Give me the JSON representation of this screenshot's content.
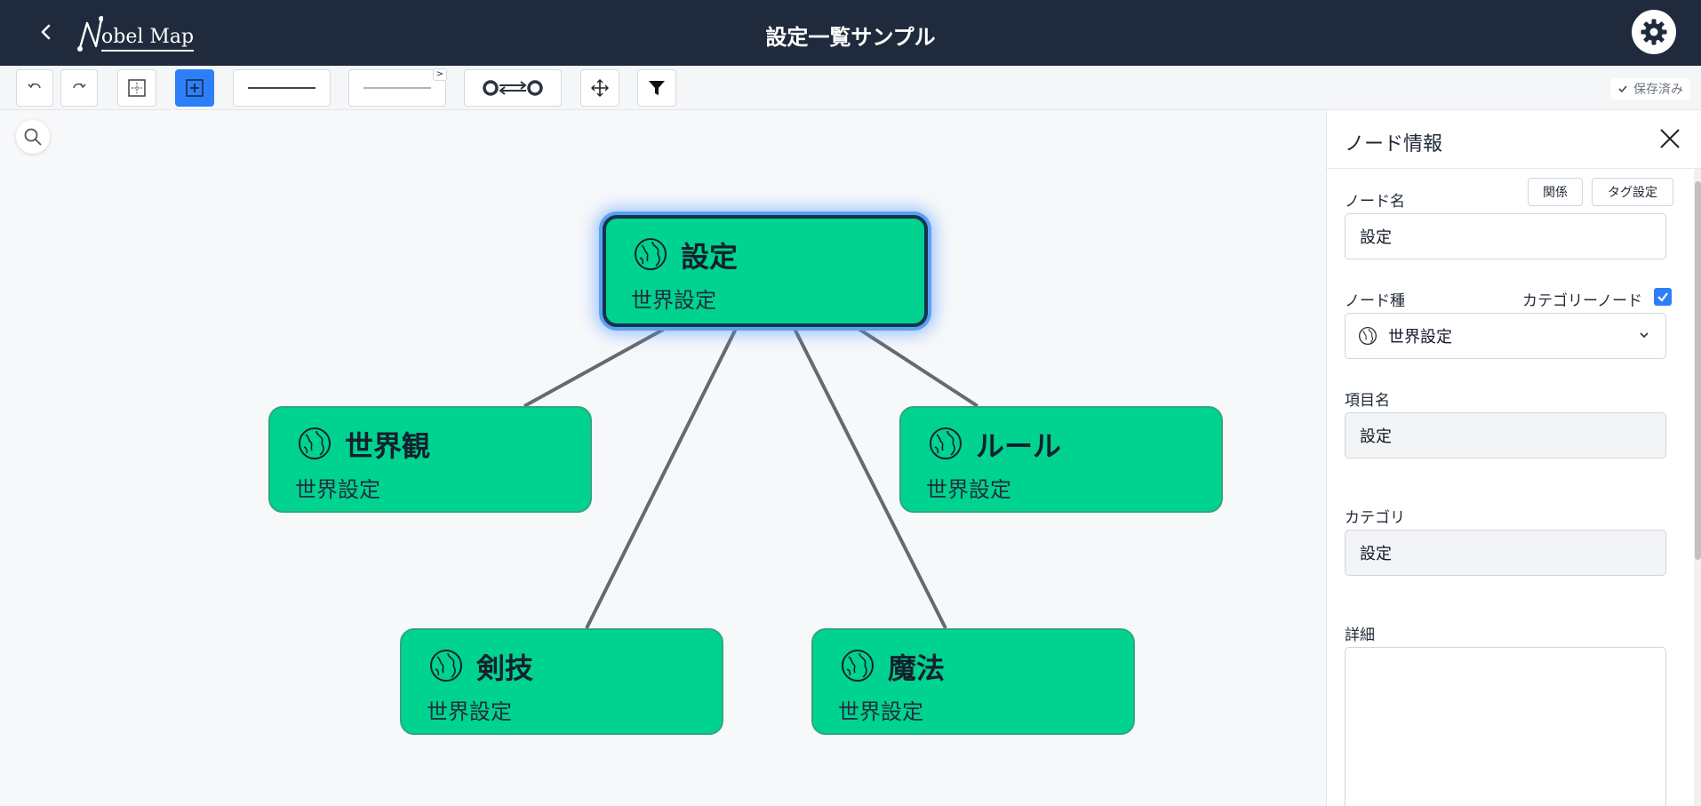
{
  "header": {
    "title": "設定一覧サンプル",
    "logo_text": "obel Map"
  },
  "toolbar": {
    "line_badge": ">",
    "saved_label": "保存済み"
  },
  "nodes": [
    {
      "name": "設定",
      "type": "世界設定",
      "selected": true
    },
    {
      "name": "世界観",
      "type": "世界設定"
    },
    {
      "name": "ルール",
      "type": "世界設定"
    },
    {
      "name": "剣技",
      "type": "世界設定"
    },
    {
      "name": "魔法",
      "type": "世界設定"
    }
  ],
  "panel": {
    "title": "ノード情報",
    "relation_button": "関係",
    "tag_button": "タグ設定",
    "node_name_label": "ノード名",
    "node_name_value": "設定",
    "node_type_label": "ノード種",
    "category_node_label": "カテゴリーノード",
    "category_node_checked": true,
    "node_type_value": "世界設定",
    "item_name_label": "項目名",
    "item_name_value": "設定",
    "category_label": "カテゴリ",
    "category_value": "設定",
    "detail_label": "詳細",
    "detail_value": ""
  },
  "colors": {
    "header_bg": "#1f2a3c",
    "node_fill": "#00d38f",
    "accent": "#2d7ff9",
    "edge": "#666a70"
  }
}
